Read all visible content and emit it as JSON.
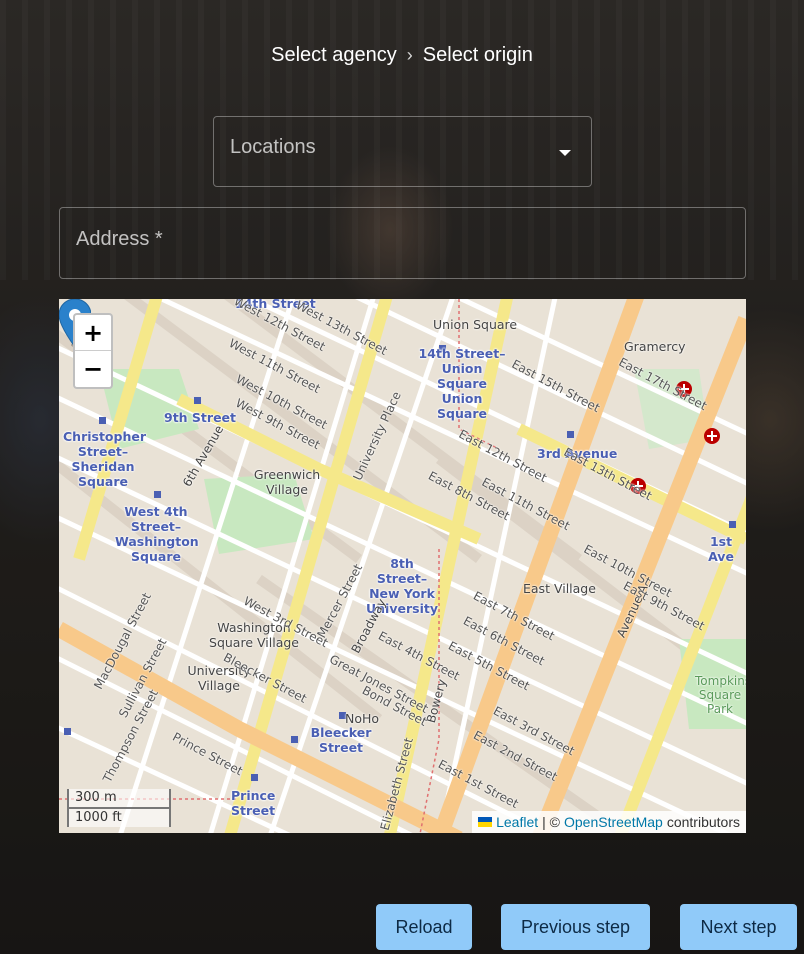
{
  "breadcrumb": {
    "step1": "Select agency",
    "separator": "›",
    "step2": "Select origin"
  },
  "locations_select": {
    "label": "Locations"
  },
  "address_field": {
    "label": "Address *"
  },
  "map": {
    "zoom_in": "+",
    "zoom_out": "−",
    "scale_metric": "300 m",
    "scale_imperial": "1000 ft",
    "attribution_leaflet": "Leaflet",
    "attribution_sep": "| ©",
    "attribution_osm": "OpenStreetMap",
    "attribution_suffix": "contributors",
    "labels": {
      "s14": "14th Street",
      "union_square": "Union Square",
      "gramercy": "Gramercy",
      "s14_union": "14th Street–Union Square Union Square",
      "ninth_street": "9th Street",
      "christopher": "Christopher Street–Sheridan Square",
      "third_ave": "3rd Avenue",
      "greenwich": "Greenwich Village",
      "w4": "West 4th Street–Washington Square",
      "eighth_nyu": "8th Street–New York University",
      "first_ave": "1st Ave",
      "east_village": "East Village",
      "wsv": "Washington Square Village",
      "uv": "University Village",
      "noho": "NoHo",
      "bleecker": "Bleecker Street",
      "prince": "Prince Street",
      "tompkins": "Tompkins Square Park",
      "broadway": "Broadway",
      "bowery": "Bowery",
      "sixth_ave": "6th Avenue",
      "avenue_a": "Avenue A",
      "west_11": "West 11th Street",
      "east_15": "East 15th Street",
      "east_12": "East 12th Street",
      "mercer": "Mercer Street",
      "great_jones": "Great Jones Street",
      "bond": "Bond Street",
      "east_4": "East 4th Street",
      "east_6": "East 6th Street",
      "university_place": "University Place",
      "west_3": "West 3rd Street",
      "bleecker_st": "Bleecker Street",
      "macdougal": "MacDougal Street",
      "sullivan": "Sullivan Street",
      "thompson": "Thompson Street",
      "prince_st": "Prince Street",
      "east_1": "East 1st Street",
      "east_7": "East 7th Street",
      "east_9": "East 9th Street",
      "east_10": "East 10th Street",
      "east_11": "East 11th Street",
      "east_13": "East 13th Street",
      "east_17": "East 17th Street",
      "east_2": "East 2nd Street",
      "east_3": "East 3rd Street",
      "west_12": "West 12th Street",
      "west_13": "West 13th Street",
      "west_10": "West 10th Street",
      "west_9": "West 9th Street",
      "east_8": "East 8th Street",
      "east_5": "East 5th Street",
      "elizabeth": "Elizabeth Street"
    }
  },
  "buttons": {
    "reload": "Reload",
    "previous": "Previous step",
    "next": "Next step"
  },
  "colors": {
    "button_bg": "#90caf9",
    "station_text": "#4a5fb3",
    "avenue": "#f8c98a",
    "street": "#ffffff",
    "park": "#c8e8c0",
    "marker": "#2a81cb"
  }
}
